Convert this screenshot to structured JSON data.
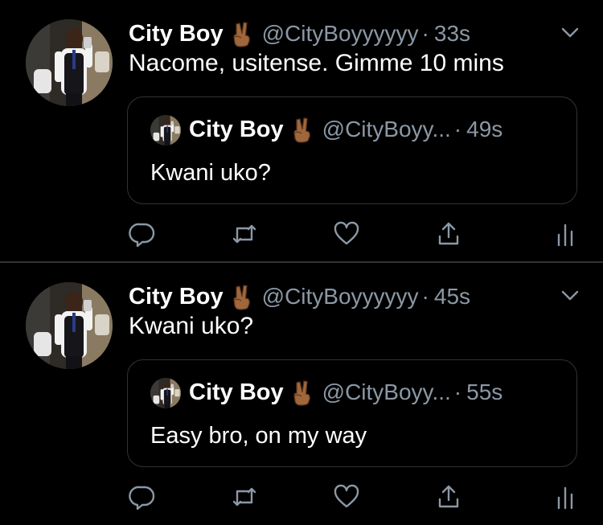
{
  "colors": {
    "background": "#000000",
    "text_primary": "#ffffff",
    "text_secondary": "#8b98a5",
    "divider": "#2f3336",
    "emoji_skin": "#a0673b"
  },
  "tweets": [
    {
      "name": "City Boy",
      "emoji_icon": "victory-hand-emoji",
      "handle": "@CityBoyyyyyy",
      "dot": "·",
      "time": "33s",
      "text": "Nacome, usitense. Gimme 10 mins",
      "quote": {
        "name": "City Boy",
        "handle": "@CityBoyy...",
        "dot": "·",
        "time": "49s",
        "text": "Kwani uko?"
      }
    },
    {
      "name": "City Boy",
      "emoji_icon": "victory-hand-emoji",
      "handle": "@CityBoyyyyyy",
      "dot": "·",
      "time": "45s",
      "text": "Kwani uko?",
      "quote": {
        "name": "City Boy",
        "handle": "@CityBoyy...",
        "dot": "·",
        "time": "55s",
        "text": "Easy bro, on my way"
      }
    }
  ],
  "action_icons": [
    "reply-icon",
    "retweet-icon",
    "like-icon",
    "share-icon",
    "analytics-icon"
  ]
}
